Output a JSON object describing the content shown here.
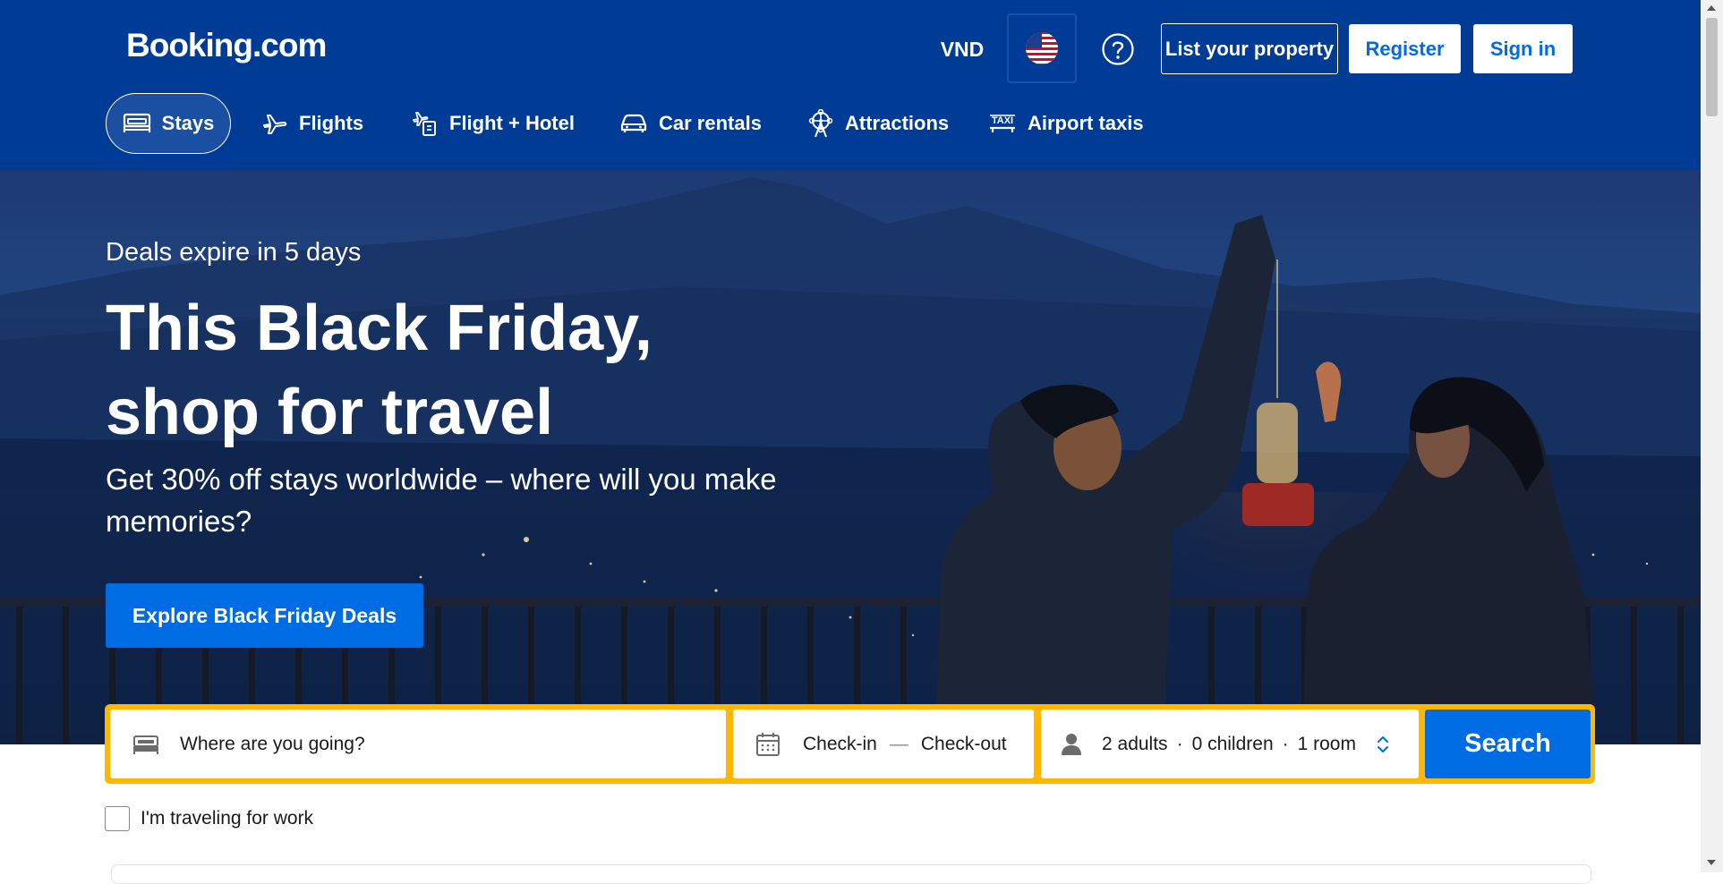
{
  "header": {
    "logo": "Booking.com",
    "currency": "VND",
    "list_property": "List your property",
    "register": "Register",
    "sign_in": "Sign in",
    "language_flag": "us-flag-icon",
    "help_icon": "help-circle-icon"
  },
  "nav": {
    "tabs": [
      {
        "label": "Stays",
        "icon": "bed-icon",
        "active": true
      },
      {
        "label": "Flights",
        "icon": "plane-icon"
      },
      {
        "label": "Flight + Hotel",
        "icon": "flight-hotel-icon"
      },
      {
        "label": "Car rentals",
        "icon": "car-icon"
      },
      {
        "label": "Attractions",
        "icon": "ferris-wheel-icon"
      },
      {
        "label": "Airport taxis",
        "icon": "taxi-icon"
      }
    ]
  },
  "hero": {
    "subtitle": "Deals expire in 5 days",
    "title_line1": "This Black Friday,",
    "title_line2": "shop for travel",
    "description": "Get 30% off stays worldwide – where will you make memories?",
    "cta": "Explore Black Friday Deals"
  },
  "search": {
    "destination_placeholder": "Where are you going?",
    "checkin": "Check-in",
    "checkout": "Check-out",
    "date_separator": "—",
    "adults": "2 adults",
    "children": "0 children",
    "rooms": "1 room",
    "dot": "·",
    "button": "Search",
    "work_travel": "I'm traveling for work"
  },
  "colors": {
    "brand_blue": "#003b95",
    "action_blue": "#006ce4",
    "search_border": "#ffb700"
  }
}
